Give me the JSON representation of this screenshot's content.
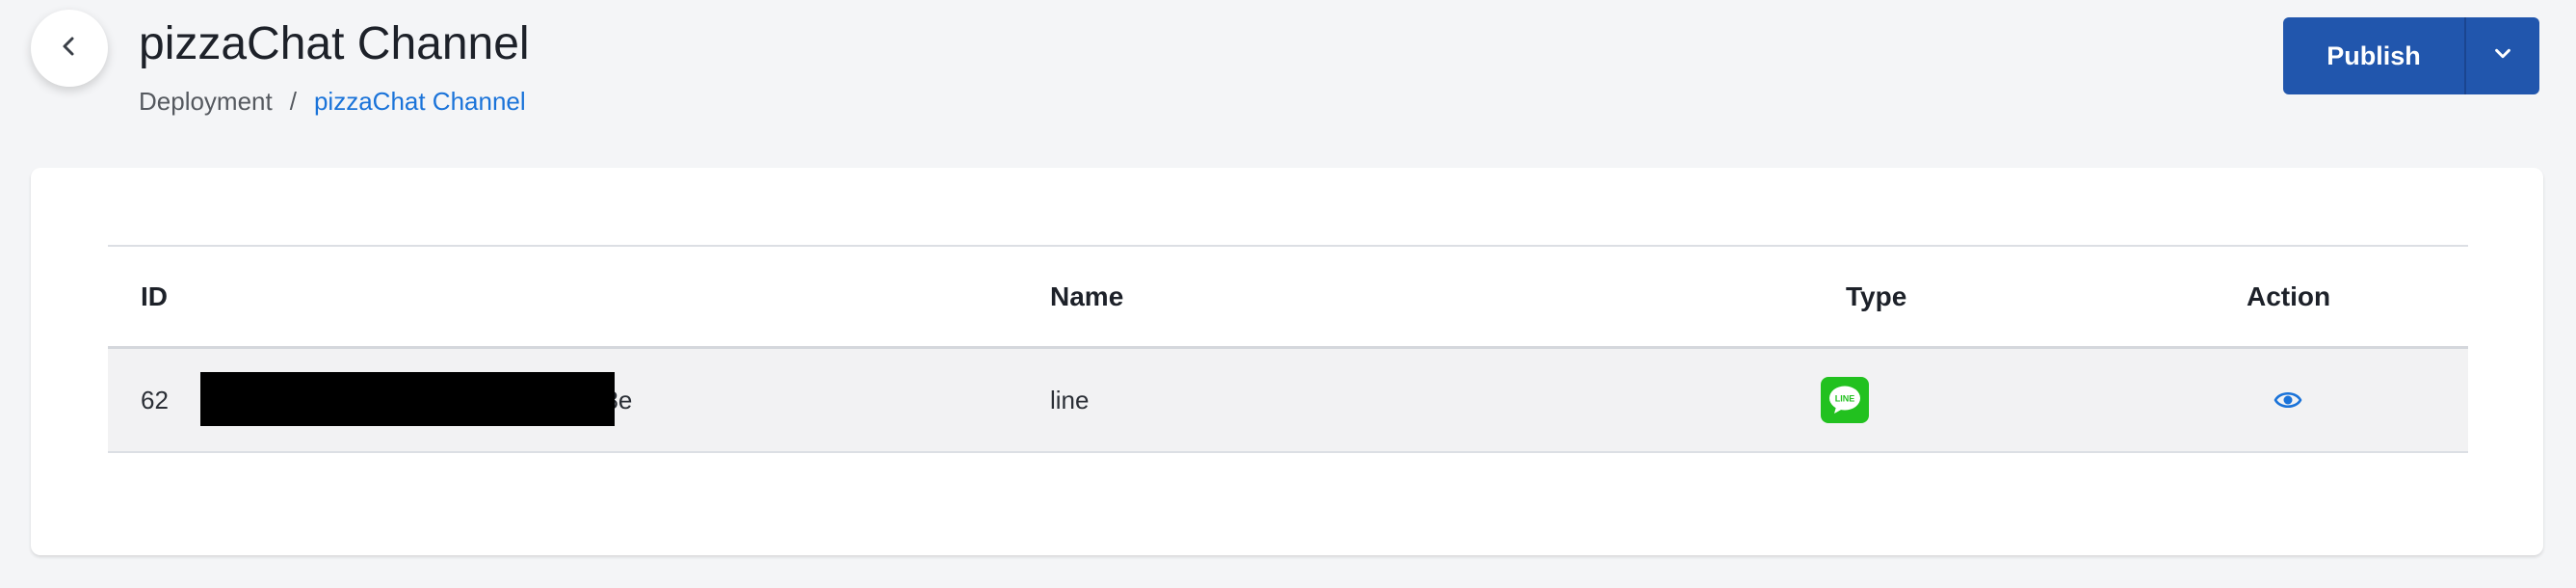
{
  "header": {
    "title": "pizzaChat Channel",
    "back_icon": "chevron-left-icon",
    "breadcrumb": {
      "root": "Deployment",
      "separator": "/",
      "current": "pizzaChat Channel"
    }
  },
  "publish": {
    "label": "Publish",
    "dropdown_icon": "chevron-down-icon",
    "color": "#2156ad"
  },
  "table": {
    "columns": [
      "ID",
      "Name",
      "Type",
      "Action"
    ],
    "rows": [
      {
        "id_prefix": "62",
        "id_suffix": "18e",
        "id_redacted": true,
        "name": "line",
        "type": "LINE",
        "type_icon": "line-app-icon",
        "type_icon_label": "LINE",
        "action_icon": "eye-icon"
      }
    ]
  },
  "colors": {
    "accent_link": "#1a73d9",
    "line_green": "#22c11f",
    "background": "#f4f5f7"
  }
}
